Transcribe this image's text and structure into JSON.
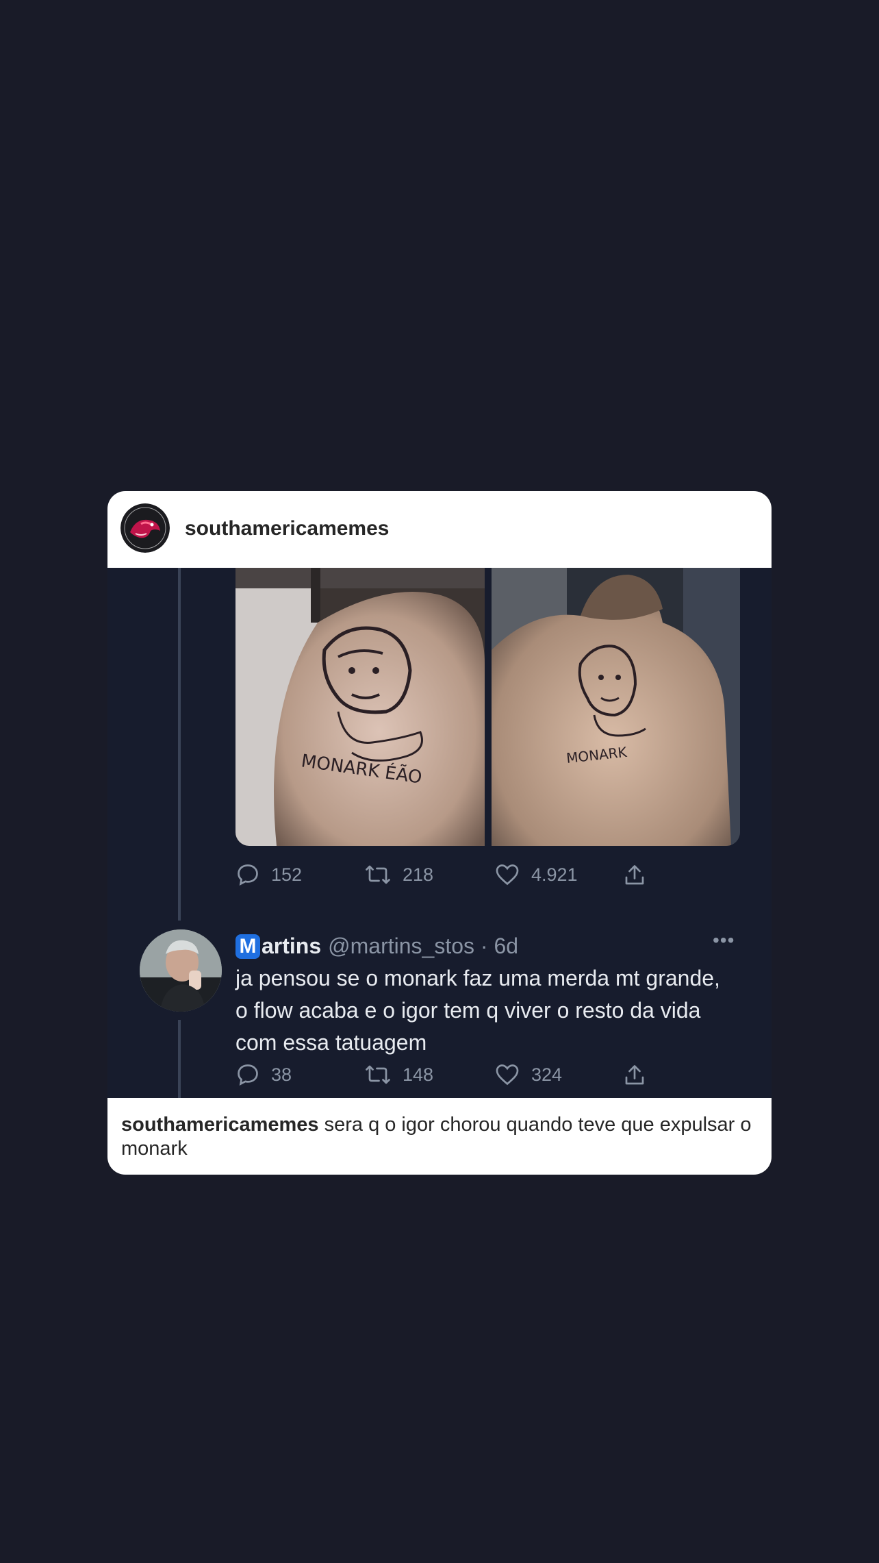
{
  "post": {
    "username": "southamericamemes",
    "caption_user": "southamericamemes",
    "caption_text": "sera q o igor chorou quando teve que expulsar o monark"
  },
  "tweet1": {
    "replies": "152",
    "retweets": "218",
    "likes": "4.921",
    "tattoo_text": "MONARK ÉÃO"
  },
  "tweet2": {
    "badge_letter": "M",
    "display_name": "artins",
    "handle": "@martins_stos · 6d",
    "more_label": "•••",
    "text": "ja pensou se o monark faz uma merda mt grande, o flow acaba e o igor tem q viver o resto da vida com essa tatuagem",
    "replies": "38",
    "retweets": "148",
    "likes": "324"
  },
  "colors": {
    "page_bg": "#191b28",
    "tweet_bg": "#171c2d",
    "card_bg": "#ffffff",
    "tweet_text": "#e8ebf0",
    "tweet_muted": "#8b95a5",
    "badge_blue": "#1f6fe0"
  },
  "icons": [
    "reply-icon",
    "retweet-icon",
    "like-icon",
    "share-icon",
    "more-icon"
  ]
}
